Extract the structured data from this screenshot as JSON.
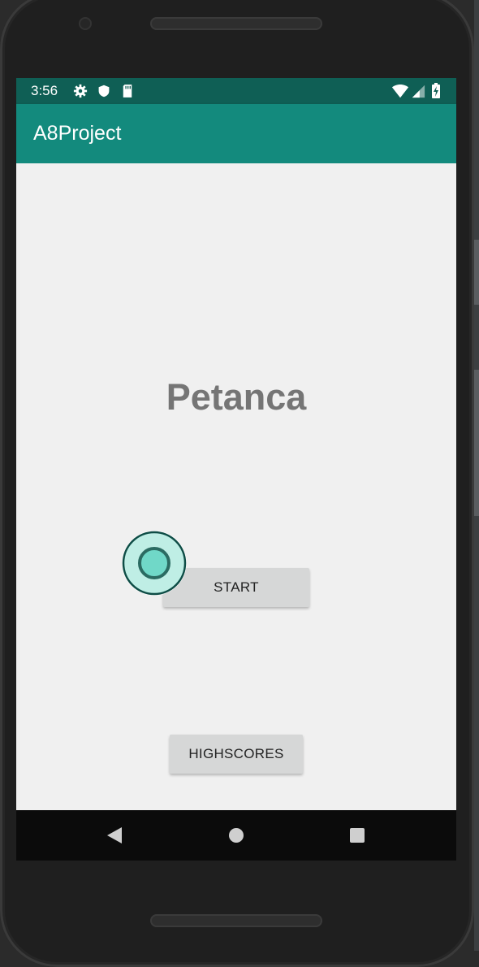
{
  "status_bar": {
    "time": "3:56",
    "left_icons": [
      "gear-icon",
      "shield-icon",
      "sd-card-icon"
    ],
    "right_icons": [
      "wifi-icon",
      "cell-signal-icon",
      "battery-charging-icon"
    ]
  },
  "app_bar": {
    "title": "A8Project"
  },
  "main": {
    "headline": "Petanca",
    "start_label": "START",
    "highscores_label": "HIGHSCORES"
  },
  "nav_bar": {
    "buttons": [
      "back-icon",
      "home-icon",
      "recents-icon"
    ]
  },
  "colors": {
    "status_bar": "#0f5f55",
    "app_bar": "#138a7d",
    "background": "#f0f0f0",
    "headline": "#757575",
    "button": "#d6d7d7",
    "nav_bar": "#0b0b0b",
    "touch_indicator": "#70d8c8"
  }
}
